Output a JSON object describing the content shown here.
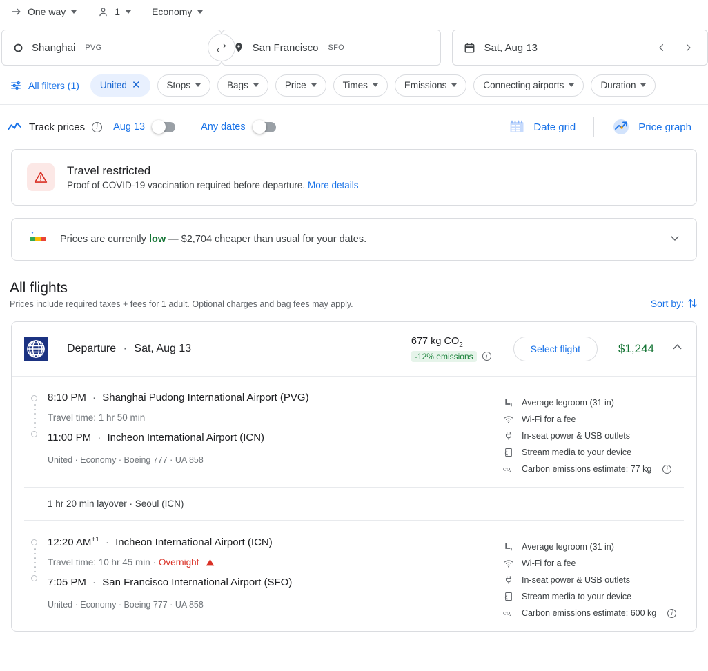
{
  "trip": {
    "type_label": "One way",
    "passengers": "1",
    "cabin": "Economy"
  },
  "search": {
    "origin_city": "Shanghai",
    "origin_code": "PVG",
    "dest_city": "San Francisco",
    "dest_code": "SFO",
    "date": "Sat, Aug 13"
  },
  "filters": {
    "all_filters_label": "All filters (1)",
    "chips": [
      {
        "label": "United",
        "active": true,
        "close": "✕"
      },
      {
        "label": "Stops",
        "active": false
      },
      {
        "label": "Bags",
        "active": false
      },
      {
        "label": "Price",
        "active": false
      },
      {
        "label": "Times",
        "active": false
      },
      {
        "label": "Emissions",
        "active": false
      },
      {
        "label": "Connecting airports",
        "active": false
      },
      {
        "label": "Duration",
        "active": false
      }
    ]
  },
  "track": {
    "label": "Track prices",
    "date_toggle_label": "Aug 13",
    "any_dates_label": "Any dates",
    "date_grid_label": "Date grid",
    "price_graph_label": "Price graph"
  },
  "alert": {
    "title": "Travel restricted",
    "text": "Proof of COVID-19 vaccination required before departure.",
    "link": "More details"
  },
  "price_notice": {
    "prefix": "Prices are currently ",
    "level": "low",
    "suffix": " — $2,704 cheaper than usual for your dates."
  },
  "section": {
    "title": "All flights",
    "subtitle_pre": "Prices include required taxes + fees for 1 adult. Optional charges and ",
    "subtitle_link": "bag fees",
    "subtitle_post": " may apply.",
    "sort_label": "Sort by:"
  },
  "flight": {
    "header": {
      "airline_logo": "united-logo",
      "route_label": "Departure",
      "route_date": "Sat, Aug 13",
      "separator": "·",
      "emissions_value": "677 kg CO",
      "emissions_sub": "2",
      "emissions_tag": "-12% emissions",
      "select_label": "Select flight",
      "price": "$1,244"
    },
    "legs": [
      {
        "depart_time": "8:10 PM",
        "depart_sup": "",
        "depart_airport": "Shanghai Pudong International Airport (PVG)",
        "travel_time": "Travel time: 1 hr 50 min",
        "overnight": "",
        "arrive_time": "11:00 PM",
        "arrive_airport": "Incheon International Airport (ICN)",
        "meta": "United · Economy · Boeing 777 · UA 858",
        "amenities": [
          {
            "icon": "legroom-icon",
            "text": "Average legroom (31 in)",
            "info": false
          },
          {
            "icon": "wifi-icon",
            "text": "Wi-Fi for a fee",
            "info": false
          },
          {
            "icon": "power-icon",
            "text": "In-seat power & USB outlets",
            "info": false
          },
          {
            "icon": "stream-media-icon",
            "text": "Stream media to your device",
            "info": false
          },
          {
            "icon": "co2-icon",
            "text": "Carbon emissions estimate: 77 kg",
            "info": true
          }
        ]
      },
      {
        "depart_time": "12:20 AM",
        "depart_sup": "+1",
        "depart_airport": "Incheon International Airport (ICN)",
        "travel_time": "Travel time: 10 hr 45 min · ",
        "overnight": "Overnight",
        "arrive_time": "7:05 PM",
        "arrive_airport": "San Francisco International Airport (SFO)",
        "meta": "United · Economy · Boeing 777 · UA 858",
        "amenities": [
          {
            "icon": "legroom-icon",
            "text": "Average legroom (31 in)",
            "info": false
          },
          {
            "icon": "wifi-icon",
            "text": "Wi-Fi for a fee",
            "info": false
          },
          {
            "icon": "power-icon",
            "text": "In-seat power & USB outlets",
            "info": false
          },
          {
            "icon": "stream-media-icon",
            "text": "Stream media to your device",
            "info": false
          },
          {
            "icon": "co2-icon",
            "text": "Carbon emissions estimate: 600 kg",
            "info": true
          }
        ]
      }
    ],
    "layover": "1 hr 20 min layover · Seoul (ICN)"
  },
  "colors": {
    "accent_blue": "#1a73e8",
    "green": "#137333",
    "red": "#d93025",
    "united_blue": "#1b3281"
  }
}
